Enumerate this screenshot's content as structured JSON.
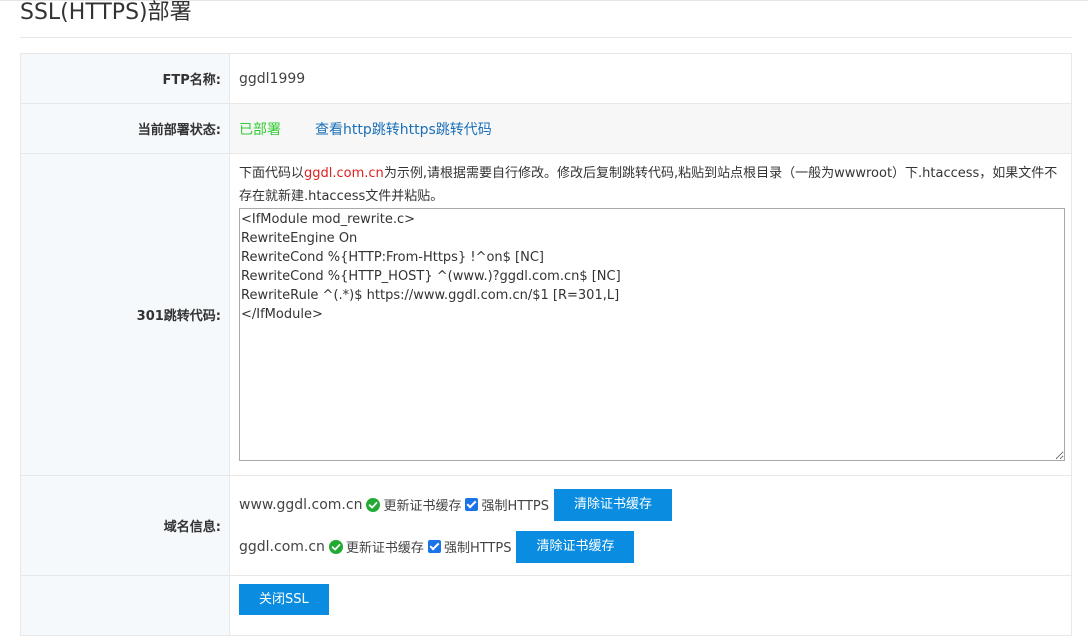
{
  "page": {
    "title": "SSL(HTTPS)部署"
  },
  "form": {
    "ftp": {
      "label": "FTP名称:",
      "value": "ggdl1999"
    },
    "status": {
      "label": "当前部署状态:",
      "value": "已部署",
      "link": "查看http跳转https跳转代码"
    },
    "code": {
      "label": "301跳转代码:",
      "note_prefix": "下面代码以",
      "note_domain": "ggdl.com.cn",
      "note_suffix": "为示例,请根据需要自行修改。修改后复制跳转代码,粘贴到站点根目录（一般为wwwroot）下.htaccess，如果文件不存在就新建.htaccess文件并粘贴。",
      "content": "<IfModule mod_rewrite.c>\nRewriteEngine On\nRewriteCond %{HTTP:From-Https} !^on$ [NC]\nRewriteCond %{HTTP_HOST} ^(www.)?ggdl.com.cn$ [NC]\nRewriteRule ^(.*)$ https://www.ggdl.com.cn/$1 [R=301,L]\n</IfModule>"
    },
    "domains": {
      "label": "域名信息:",
      "items": [
        {
          "domain": "www.ggdl.com.cn",
          "refresh_label": "更新证书缓存",
          "force_label": "强制HTTPS",
          "force_checked": true,
          "button": "清除证书缓存"
        },
        {
          "domain": "ggdl.com.cn",
          "refresh_label": "更新证书缓存",
          "force_label": "强制HTTPS",
          "force_checked": true,
          "button": "清除证书缓存"
        }
      ]
    },
    "close_button": "关闭SSL"
  },
  "colors": {
    "primary_button": "#0a8de0",
    "status_green": "#33cc33",
    "link_blue": "#1a6fb8",
    "highlight_red": "#e02020",
    "label_bg": "#f5f9fc"
  },
  "icons": {
    "ok": "check-circle-icon",
    "checkbox": "checkbox-checked-icon"
  }
}
